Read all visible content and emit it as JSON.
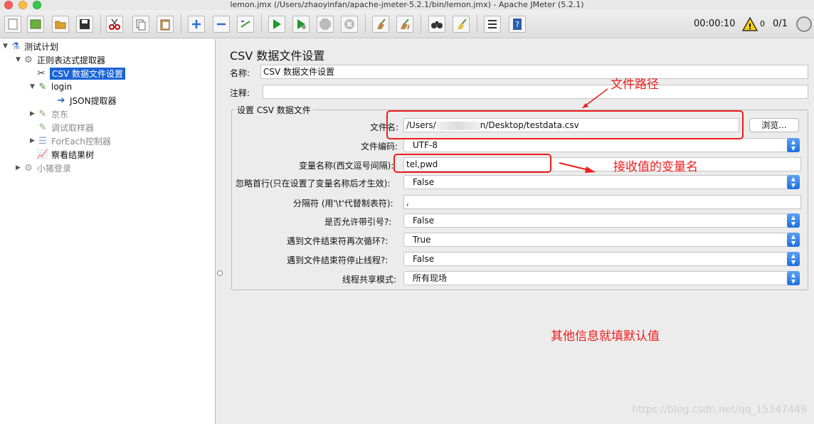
{
  "window": {
    "title": "lemon.jmx (/Users/zhaoyinfan/apache-jmeter-5.2.1/bin/lemon.jmx) - Apache JMeter (5.2.1)"
  },
  "toolbar": {
    "buttons": [
      "new-icon",
      "templates-icon",
      "open-icon",
      "save-icon",
      "cut-icon",
      "copy-icon",
      "paste-icon",
      "expand-icon",
      "collapse-icon",
      "toggle-icon",
      "start-icon",
      "start-no-pause-icon",
      "stop-icon",
      "shutdown-icon",
      "clear-icon",
      "clear-all-icon",
      "search-icon",
      "reset-search-icon",
      "function-helper-icon",
      "help-icon"
    ],
    "timer": "00:00:10",
    "warnings": "0",
    "threads": "0/1"
  },
  "tree": {
    "items": [
      {
        "label": "测试计划",
        "icon": "test-plan-icon",
        "state": "normal"
      },
      {
        "label": "正则表达式提取器",
        "icon": "thread-group-icon",
        "state": "normal"
      },
      {
        "label": "CSV 数据文件设置",
        "icon": "config-wrench-icon",
        "state": "selected"
      },
      {
        "label": "login",
        "icon": "sampler-icon",
        "state": "normal"
      },
      {
        "label": "JSON提取器",
        "icon": "extractor-icon",
        "state": "normal"
      },
      {
        "label": "京东",
        "icon": "sampler-icon",
        "state": "disabled"
      },
      {
        "label": "调试取样器",
        "icon": "sampler-icon",
        "state": "disabled"
      },
      {
        "label": "ForEach控制器",
        "icon": "controller-icon",
        "state": "disabled"
      },
      {
        "label": "察看结果树",
        "icon": "listener-icon",
        "state": "normal"
      },
      {
        "label": "小猪登录",
        "icon": "thread-group-icon",
        "state": "disabled"
      }
    ]
  },
  "panel": {
    "title": "CSV 数据文件设置",
    "name_label": "名称:",
    "name_value": "CSV 数据文件设置",
    "comment_label": "注释:",
    "comment_value": "",
    "group_title": "设置 CSV 数据文件",
    "filename_label": "文件名:",
    "filename_prefix": "/Users/",
    "filename_suffix": "n/Desktop/testdata.csv",
    "browse_label": "浏览...",
    "encoding_label": "文件编码:",
    "encoding_value": "UTF-8",
    "varnames_label": "变量名称(西文逗号间隔):",
    "varnames_value": "tel,pwd",
    "ignore_first_label": "忽略首行(只在设置了变量名称后才生效):",
    "ignore_first_value": "False",
    "delimiter_label": "分隔符 (用'\\t'代替制表符):",
    "delimiter_value": ",",
    "quoted_label": "是否允许带引号?:",
    "quoted_value": "False",
    "recycle_label": "遇到文件结束符再次循环?:",
    "recycle_value": "True",
    "stop_thread_label": "遇到文件结束符停止线程?:",
    "stop_thread_value": "False",
    "sharing_label": "线程共享模式:",
    "sharing_value": "所有现场"
  },
  "annotations": {
    "file_path": "文件路径",
    "var_name": "接收值的变量名",
    "others_default": "其他信息就填默认值",
    "color": "#ee1c1c"
  },
  "watermark": "https://blog.csdn.net/qq_15347449"
}
